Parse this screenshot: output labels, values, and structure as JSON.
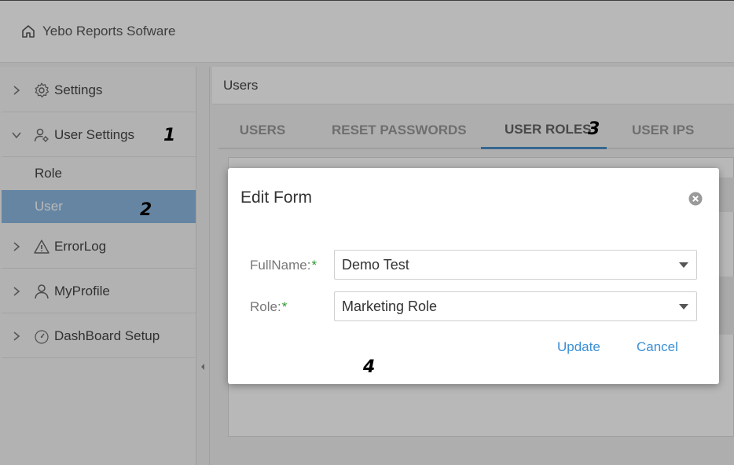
{
  "app": {
    "title": "Yebo Reports Sofware"
  },
  "sidebar": {
    "items": [
      {
        "label": "Settings",
        "icon": "gear-icon"
      },
      {
        "label": "User Settings",
        "icon": "user-settings-icon"
      },
      {
        "label": "ErrorLog",
        "icon": "warning-icon"
      },
      {
        "label": "MyProfile",
        "icon": "person-icon"
      },
      {
        "label": "DashBoard Setup",
        "icon": "dashboard-icon"
      }
    ],
    "subitems": [
      {
        "label": "Role"
      },
      {
        "label": "User",
        "active": true
      }
    ]
  },
  "main": {
    "header": "Users",
    "tabs": [
      {
        "label": "USERS"
      },
      {
        "label": "RESET PASSWORDS"
      },
      {
        "label": "USER ROLES",
        "active": true
      },
      {
        "label": "USER IPS"
      }
    ]
  },
  "modal": {
    "title": "Edit Form",
    "fields": [
      {
        "label": "FullName:",
        "required_mark": "*",
        "value": "Demo Test"
      },
      {
        "label": "Role:",
        "required_mark": "*",
        "value": "Marketing Role"
      }
    ],
    "update_label": "Update",
    "cancel_label": "Cancel"
  },
  "annotations": [
    "1",
    "2",
    "3",
    "4"
  ],
  "colors": {
    "accent": "#3b8fd4",
    "active_sidebar": "#8db9e2",
    "required": "#2a9a2a"
  }
}
